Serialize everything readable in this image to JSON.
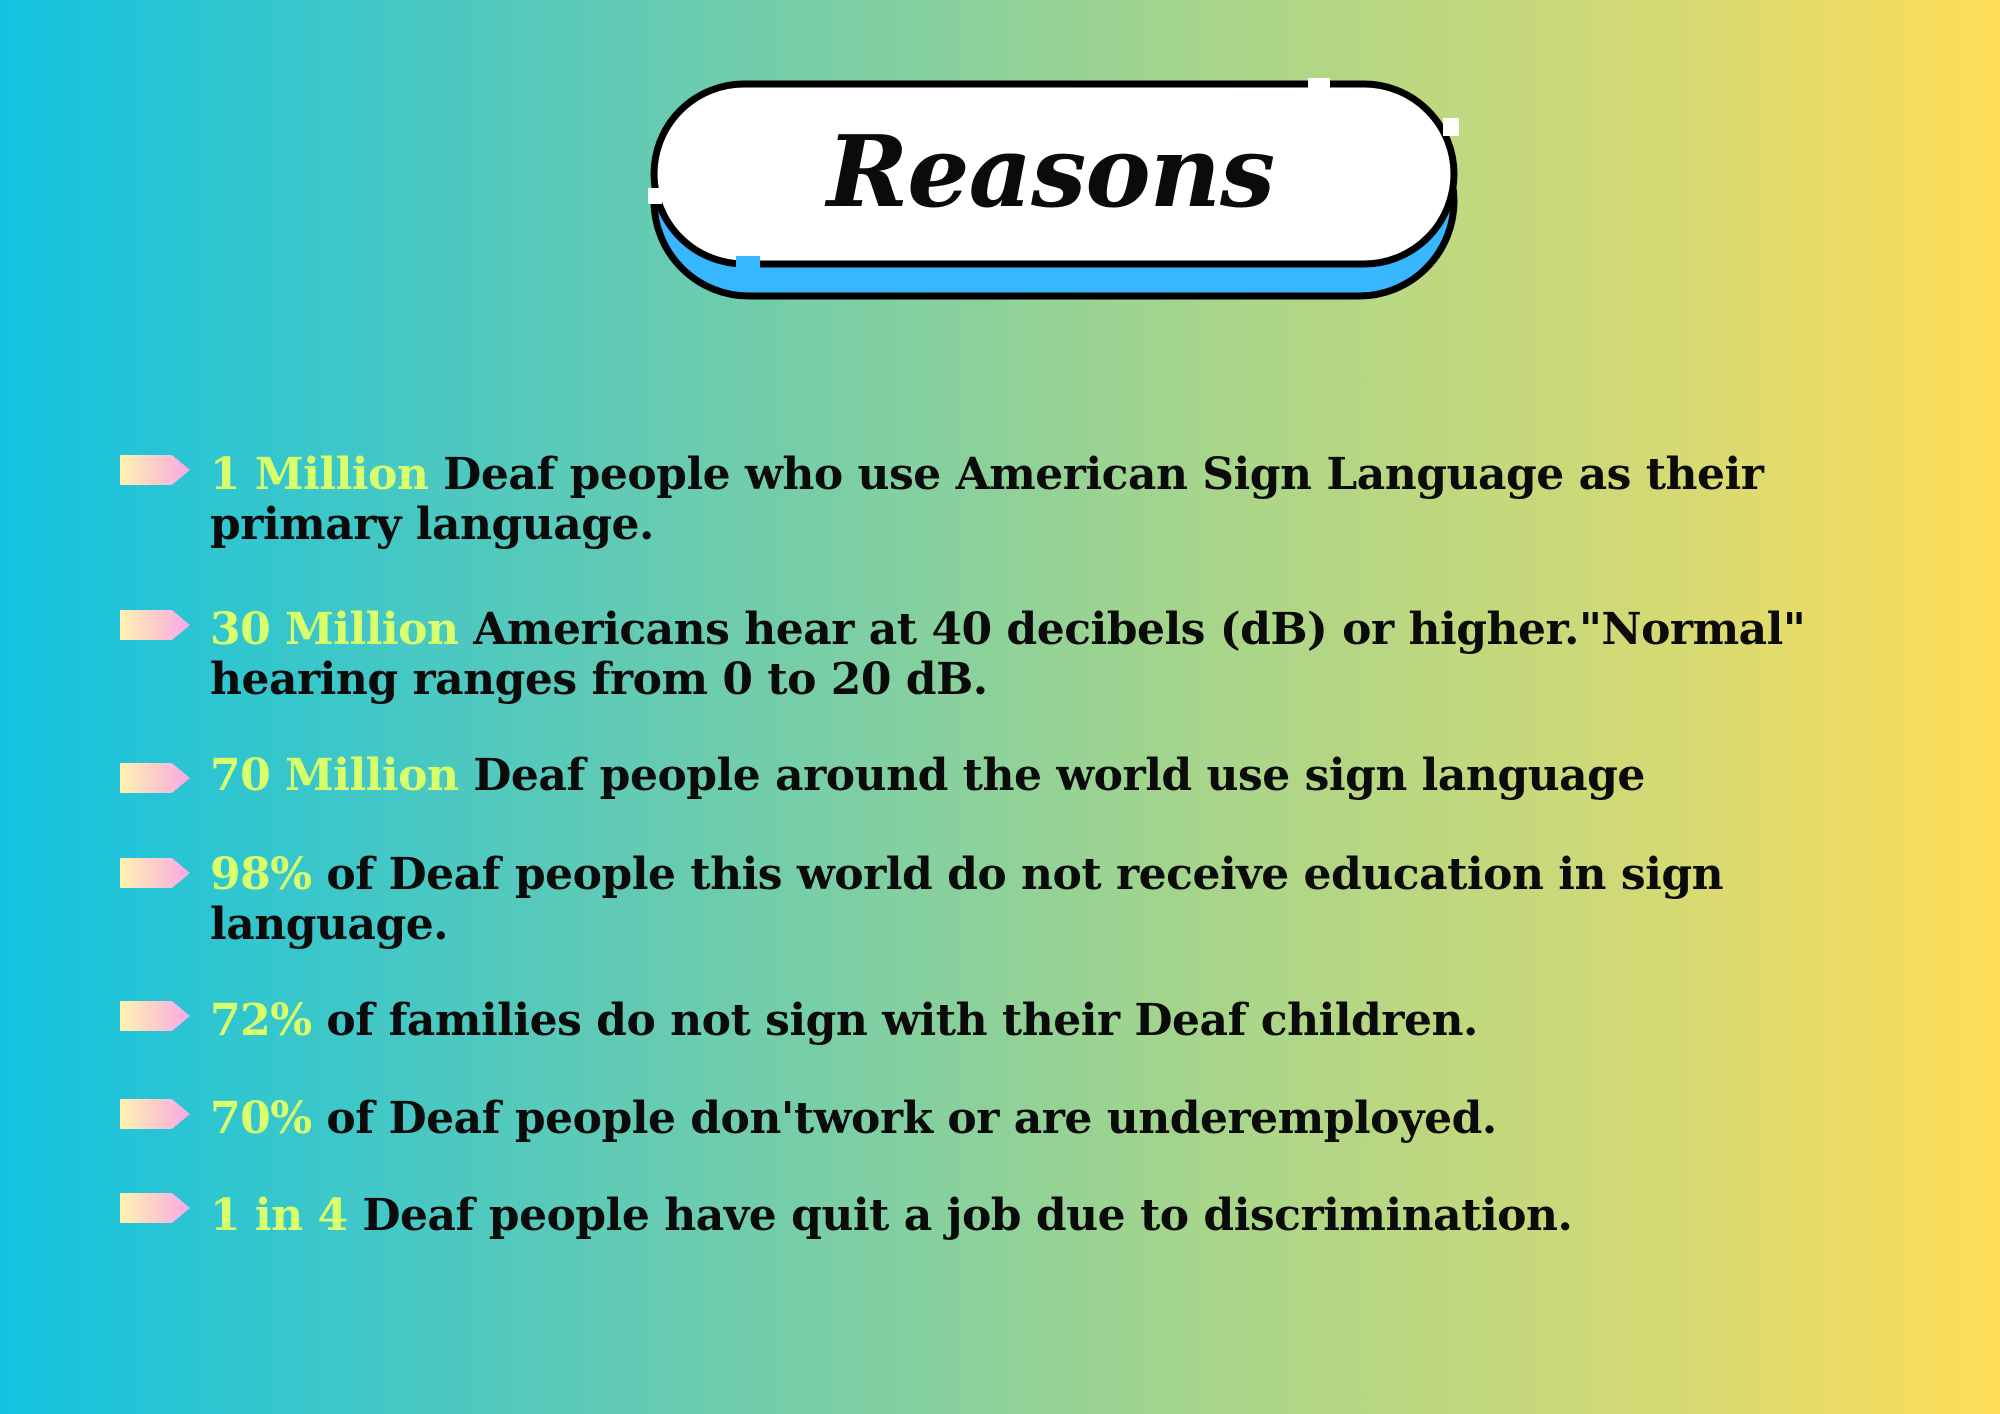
{
  "title": "Reasons",
  "colors": {
    "highlight": "#d9ff6b",
    "text": "#0b0b0b",
    "badge_fill": "#ffffff",
    "badge_shadow": "#38b6ff",
    "arrow_gradient_start": "#fff3b0",
    "arrow_gradient_end": "#f9a8e6"
  },
  "icons": {
    "bullet": "arrow-tag-icon"
  },
  "reasons": [
    {
      "highlight": "1 Million",
      "text": " Deaf people who use American Sign Language as their primary language."
    },
    {
      "highlight": " 30 Million",
      "text": " Americans hear at 40 decibels (dB) or higher.\"Normal\" hearing ranges from 0 to 20 dB."
    },
    {
      "highlight": " 70 Million",
      "text": " Deaf people around the world use sign language"
    },
    {
      "highlight": " 98%",
      "text": " of Deaf people this world do not receive education in sign language."
    },
    {
      "highlight": " 72%",
      "text": " of families do not sign with their Deaf children."
    },
    {
      "highlight": " 70%",
      "text": " of Deaf people don'twork or are underemployed."
    },
    {
      "highlight": " 1 in 4",
      "text": " Deaf people have quit a job due to discrimination."
    }
  ]
}
